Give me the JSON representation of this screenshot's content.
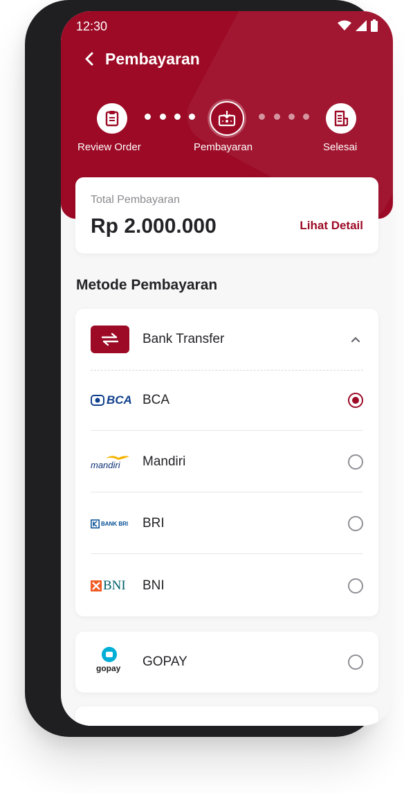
{
  "status_bar": {
    "time": "12:30"
  },
  "header": {
    "title": "Pembayaran"
  },
  "steps": [
    {
      "label": "Review Order",
      "icon": "clipboard-icon"
    },
    {
      "label": "Pembayaran",
      "icon": "payment-icon",
      "active": true
    },
    {
      "label": "Selesai",
      "icon": "receipt-icon"
    }
  ],
  "total": {
    "label": "Total Pembayaran",
    "amount": "Rp 2.000.000",
    "detail_link": "Lihat Detail"
  },
  "section_title": "Metode Pembayaran",
  "bank_transfer": {
    "label": "Bank Transfer",
    "expanded": true
  },
  "banks": [
    {
      "name": "BCA",
      "logo_text": "BCA",
      "selected": true
    },
    {
      "name": "Mandiri",
      "logo_text": "mandiri",
      "selected": false
    },
    {
      "name": "BRI",
      "logo_text": "BANK BRI",
      "selected": false
    },
    {
      "name": "BNI",
      "logo_text": "BNI",
      "selected": false
    }
  ],
  "gopay": {
    "name": "GOPAY",
    "logo_text": "gopay",
    "selected": false
  },
  "colors": {
    "brand": "#9c0a25",
    "text": "#232327",
    "muted": "#8a8a8f",
    "background": "#f7f7f8"
  }
}
